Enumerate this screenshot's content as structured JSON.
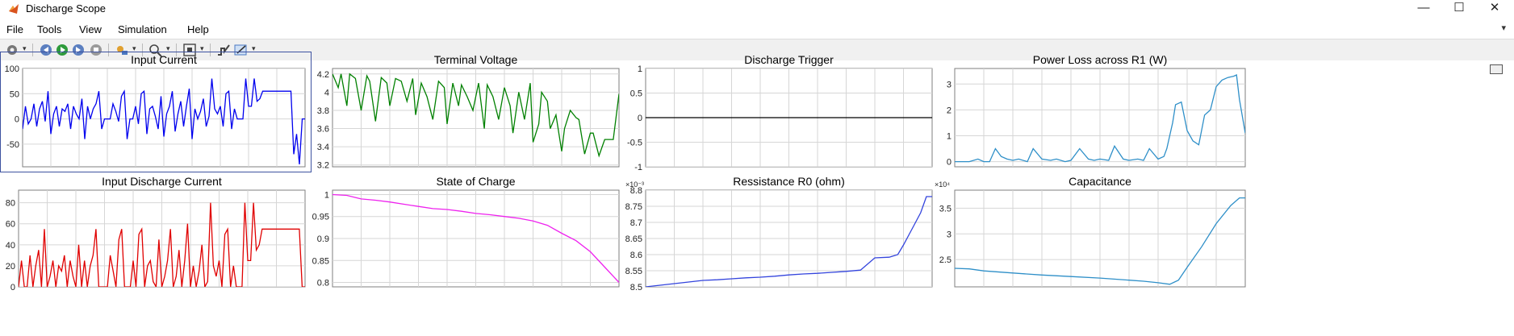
{
  "window": {
    "title": "Discharge Scope",
    "minimize": "—",
    "maximize": "☐",
    "close": "✕"
  },
  "menu": [
    "File",
    "Tools",
    "View",
    "Simulation",
    "Help"
  ],
  "toolbar": {
    "dock_caret": "▾"
  },
  "chart_data": [
    {
      "type": "line",
      "title": "Input Current",
      "yticks": [
        "100",
        "50",
        "0",
        "-50"
      ],
      "ylim": [
        -95,
        100
      ],
      "grid": true,
      "series": [
        {
          "color": "#0000ee",
          "x": [
            0,
            0.01,
            0.02,
            0.03,
            0.04,
            0.05,
            0.06,
            0.07,
            0.08,
            0.09,
            0.1,
            0.11,
            0.12,
            0.13,
            0.14,
            0.15,
            0.16,
            0.17,
            0.18,
            0.19,
            0.2,
            0.21,
            0.22,
            0.23,
            0.24,
            0.25,
            0.26,
            0.27,
            0.28,
            0.29,
            0.3,
            0.31,
            0.32,
            0.33,
            0.34,
            0.35,
            0.36,
            0.37,
            0.38,
            0.39,
            0.4,
            0.41,
            0.42,
            0.43,
            0.44,
            0.45,
            0.46,
            0.47,
            0.48,
            0.49,
            0.5,
            0.51,
            0.52,
            0.53,
            0.54,
            0.55,
            0.56,
            0.57,
            0.58,
            0.59,
            0.6,
            0.61,
            0.62,
            0.63,
            0.64,
            0.65,
            0.66,
            0.67,
            0.68,
            0.69,
            0.7,
            0.71,
            0.72,
            0.73,
            0.74,
            0.75,
            0.76,
            0.77,
            0.78,
            0.79,
            0.8,
            0.81,
            0.82,
            0.83,
            0.84,
            0.85,
            0.86,
            0.87,
            0.88,
            0.89,
            0.9,
            0.91,
            0.92,
            0.93,
            0.94,
            0.95,
            0.96,
            0.97,
            0.98,
            0.99,
            1
          ],
          "y": [
            -20,
            25,
            -10,
            0,
            30,
            -15,
            20,
            35,
            -5,
            55,
            -30,
            10,
            25,
            -15,
            20,
            15,
            30,
            -20,
            25,
            10,
            0,
            40,
            -40,
            25,
            0,
            20,
            30,
            55,
            -20,
            0,
            0,
            0,
            30,
            15,
            -5,
            45,
            55,
            -40,
            0,
            0,
            25,
            -10,
            50,
            55,
            -30,
            20,
            25,
            5,
            -20,
            45,
            -35,
            10,
            25,
            55,
            -25,
            10,
            35,
            -15,
            25,
            60,
            -40,
            20,
            0,
            15,
            40,
            -15,
            5,
            80,
            20,
            10,
            25,
            -15,
            50,
            55,
            -20,
            20,
            0,
            0,
            0,
            80,
            25,
            25,
            80,
            35,
            40,
            55,
            55,
            55,
            55,
            55,
            55,
            55,
            55,
            55,
            55,
            55,
            -70,
            -30,
            -90,
            0,
            0
          ]
        }
      ]
    },
    {
      "type": "line",
      "title": "Terminal Voltage",
      "yticks": [
        "4.2",
        "4",
        "3.8",
        "3.6",
        "3.4",
        "3.2"
      ],
      "ylim": [
        3.18,
        4.26
      ],
      "grid": true,
      "series": [
        {
          "color": "#008000",
          "x": [
            0,
            0.02,
            0.03,
            0.05,
            0.06,
            0.08,
            0.1,
            0.12,
            0.13,
            0.15,
            0.17,
            0.19,
            0.2,
            0.22,
            0.24,
            0.26,
            0.28,
            0.29,
            0.31,
            0.33,
            0.35,
            0.37,
            0.39,
            0.4,
            0.42,
            0.44,
            0.45,
            0.47,
            0.49,
            0.51,
            0.53,
            0.54,
            0.56,
            0.58,
            0.6,
            0.62,
            0.63,
            0.65,
            0.67,
            0.69,
            0.7,
            0.72,
            0.73,
            0.75,
            0.76,
            0.78,
            0.8,
            0.81,
            0.83,
            0.85,
            0.86,
            0.88,
            0.9,
            0.91,
            0.93,
            0.95,
            0.97,
            0.98,
            1
          ],
          "y": [
            4.2,
            4.05,
            4.2,
            3.85,
            4.2,
            4.15,
            3.8,
            4.18,
            4.12,
            3.68,
            4.16,
            4.1,
            3.85,
            4.15,
            4.12,
            3.9,
            4.15,
            3.75,
            4.1,
            3.95,
            3.7,
            4.12,
            4.05,
            3.65,
            4.1,
            3.85,
            4.08,
            3.95,
            3.8,
            4.1,
            3.6,
            4.08,
            3.95,
            3.7,
            4.05,
            3.85,
            3.55,
            4.0,
            3.7,
            4.1,
            3.45,
            3.65,
            4.0,
            3.9,
            3.6,
            3.75,
            3.35,
            3.6,
            3.8,
            3.72,
            3.7,
            3.32,
            3.55,
            3.55,
            3.3,
            3.48,
            3.48,
            3.48,
            3.98
          ]
        }
      ]
    },
    {
      "type": "line",
      "title": "Discharge Trigger",
      "yticks": [
        "1",
        "0.5",
        "0",
        "-0.5",
        "-1"
      ],
      "ylim": [
        -1,
        1
      ],
      "grid": true,
      "series": [
        {
          "color": "#000000",
          "x": [
            0,
            1
          ],
          "y": [
            0,
            0
          ]
        }
      ]
    },
    {
      "type": "line",
      "title": "Power Loss across R1 (W)",
      "yticks": [
        "3",
        "2",
        "1",
        "0"
      ],
      "ylim": [
        -0.2,
        3.6
      ],
      "grid": true,
      "series": [
        {
          "color": "#2e8fc8",
          "x": [
            0,
            0.05,
            0.08,
            0.1,
            0.12,
            0.14,
            0.16,
            0.18,
            0.2,
            0.22,
            0.25,
            0.27,
            0.3,
            0.33,
            0.35,
            0.38,
            0.4,
            0.43,
            0.46,
            0.48,
            0.5,
            0.53,
            0.55,
            0.58,
            0.6,
            0.63,
            0.65,
            0.67,
            0.7,
            0.72,
            0.73,
            0.75,
            0.76,
            0.78,
            0.8,
            0.82,
            0.84,
            0.86,
            0.87,
            0.88,
            0.9,
            0.92,
            0.94,
            0.96,
            0.97,
            0.98,
            1
          ],
          "y": [
            0,
            0,
            0.1,
            0,
            0,
            0.5,
            0.2,
            0.1,
            0.05,
            0.1,
            0,
            0.5,
            0.1,
            0.05,
            0.1,
            0,
            0.05,
            0.5,
            0.1,
            0.05,
            0.1,
            0.05,
            0.6,
            0.1,
            0.05,
            0.1,
            0.05,
            0.5,
            0.1,
            0.2,
            0.5,
            1.5,
            2.2,
            2.3,
            1.2,
            0.8,
            0.65,
            1.8,
            1.9,
            2.0,
            2.9,
            3.15,
            3.25,
            3.3,
            3.35,
            2.4,
            1.1
          ]
        }
      ]
    },
    {
      "type": "line",
      "title": "Input Discharge Current",
      "yticks": [
        "80",
        "60",
        "40",
        "20",
        "0"
      ],
      "ylim": [
        0,
        92
      ],
      "grid": true,
      "series": [
        {
          "color": "#e00000",
          "x": [
            0,
            0.01,
            0.02,
            0.03,
            0.04,
            0.05,
            0.06,
            0.07,
            0.08,
            0.09,
            0.1,
            0.11,
            0.12,
            0.13,
            0.14,
            0.15,
            0.16,
            0.17,
            0.18,
            0.19,
            0.2,
            0.21,
            0.22,
            0.23,
            0.24,
            0.25,
            0.26,
            0.27,
            0.28,
            0.29,
            0.3,
            0.31,
            0.32,
            0.33,
            0.34,
            0.35,
            0.36,
            0.37,
            0.38,
            0.39,
            0.4,
            0.41,
            0.42,
            0.43,
            0.44,
            0.45,
            0.46,
            0.47,
            0.48,
            0.49,
            0.5,
            0.51,
            0.52,
            0.53,
            0.54,
            0.55,
            0.56,
            0.57,
            0.58,
            0.59,
            0.6,
            0.61,
            0.62,
            0.63,
            0.64,
            0.65,
            0.66,
            0.67,
            0.68,
            0.69,
            0.7,
            0.71,
            0.72,
            0.73,
            0.74,
            0.75,
            0.76,
            0.77,
            0.78,
            0.79,
            0.8,
            0.81,
            0.82,
            0.83,
            0.84,
            0.85,
            0.86,
            0.87,
            0.88,
            0.89,
            0.9,
            0.91,
            0.92,
            0.93,
            0.94,
            0.95,
            0.96,
            0.97,
            0.98,
            0.99,
            1
          ],
          "y": [
            0,
            25,
            0,
            0,
            30,
            0,
            20,
            35,
            0,
            55,
            0,
            10,
            25,
            0,
            20,
            15,
            30,
            0,
            25,
            10,
            0,
            40,
            0,
            25,
            0,
            20,
            30,
            55,
            0,
            0,
            0,
            0,
            30,
            15,
            0,
            45,
            55,
            0,
            0,
            0,
            25,
            0,
            50,
            55,
            0,
            20,
            25,
            5,
            0,
            45,
            0,
            10,
            25,
            55,
            0,
            10,
            35,
            0,
            25,
            60,
            0,
            20,
            0,
            15,
            40,
            0,
            5,
            80,
            20,
            10,
            25,
            0,
            50,
            55,
            0,
            20,
            0,
            0,
            0,
            80,
            25,
            25,
            80,
            35,
            40,
            55,
            55,
            55,
            55,
            55,
            55,
            55,
            55,
            55,
            55,
            55,
            55,
            55,
            55,
            0,
            0
          ]
        }
      ]
    },
    {
      "type": "line",
      "title": "State of Charge",
      "yticks": [
        "1",
        "0.95",
        "0.9",
        "0.85",
        "0.8"
      ],
      "ylim": [
        0.79,
        1.01
      ],
      "grid": true,
      "series": [
        {
          "color": "#ee22ee",
          "x": [
            0,
            0.05,
            0.1,
            0.15,
            0.2,
            0.25,
            0.3,
            0.35,
            0.4,
            0.45,
            0.5,
            0.55,
            0.6,
            0.65,
            0.7,
            0.75,
            0.8,
            0.85,
            0.9,
            0.95,
            1
          ],
          "y": [
            1,
            0.998,
            0.99,
            0.987,
            0.983,
            0.978,
            0.973,
            0.968,
            0.966,
            0.962,
            0.957,
            0.954,
            0.95,
            0.946,
            0.94,
            0.93,
            0.912,
            0.895,
            0.87,
            0.835,
            0.8
          ]
        }
      ]
    },
    {
      "type": "line",
      "title": "Ressistance R0 (ohm)",
      "yticks": [
        "8.8",
        "8.75",
        "8.7",
        "8.65",
        "8.6",
        "8.55",
        "8.5"
      ],
      "exponent": "×10⁻³",
      "ylim": [
        8.5,
        8.8
      ],
      "grid": true,
      "series": [
        {
          "color": "#3344dd",
          "x": [
            0,
            0.05,
            0.1,
            0.15,
            0.2,
            0.25,
            0.3,
            0.35,
            0.4,
            0.45,
            0.5,
            0.55,
            0.6,
            0.65,
            0.7,
            0.75,
            0.8,
            0.85,
            0.88,
            0.9,
            0.93,
            0.96,
            0.98,
            1
          ],
          "y": [
            8.5,
            8.505,
            8.51,
            8.515,
            8.52,
            8.522,
            8.525,
            8.528,
            8.53,
            8.533,
            8.537,
            8.54,
            8.542,
            8.545,
            8.548,
            8.552,
            8.59,
            8.592,
            8.6,
            8.63,
            8.68,
            8.73,
            8.78,
            8.78
          ]
        }
      ]
    },
    {
      "type": "line",
      "title": "Capacitance",
      "yticks": [
        "3.5",
        "3",
        "2.5"
      ],
      "exponent": "×10⁴",
      "ylim": [
        1.97,
        3.85
      ],
      "grid": true,
      "series": [
        {
          "color": "#2e8fc8",
          "x": [
            0,
            0.05,
            0.1,
            0.2,
            0.3,
            0.4,
            0.5,
            0.6,
            0.65,
            0.7,
            0.74,
            0.77,
            0.8,
            0.85,
            0.9,
            0.95,
            0.98,
            1
          ],
          "y": [
            2.33,
            2.32,
            2.28,
            2.24,
            2.2,
            2.17,
            2.14,
            2.1,
            2.08,
            2.05,
            2.02,
            2.1,
            2.35,
            2.75,
            3.2,
            3.55,
            3.7,
            3.7
          ]
        }
      ]
    }
  ]
}
